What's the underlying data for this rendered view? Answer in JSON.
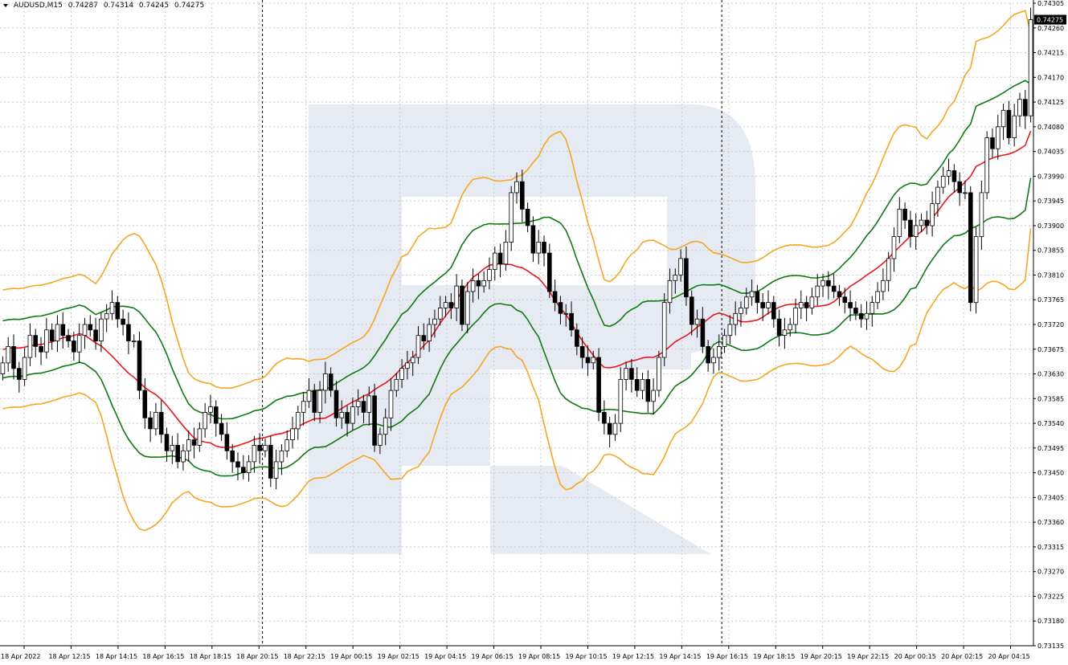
{
  "header": {
    "symbol": "AUDUSD,M15",
    "open": "0.74287",
    "high": "0.74314",
    "low": "0.74245",
    "close": "0.74275"
  },
  "colors": {
    "background": "#ffffff",
    "grid": "#c8c8c8",
    "candle_up": "#ffffff",
    "candle_down": "#000000",
    "candle_outline": "#000000",
    "middle_band": "#e8171d",
    "inner_band": "#0d7a12",
    "outer_band": "#f5a623",
    "watermark": "#e6ebf3",
    "price_tag_bg": "#000000",
    "price_tag_fg": "#ffffff"
  },
  "watermark_icon": "rounded-R-logo",
  "chart_data": {
    "type": "candlestick",
    "title": "",
    "current_price": 0.74275,
    "price_ticks": [
      "0.74305",
      "0.74260",
      "0.74215",
      "0.74170",
      "0.74125",
      "0.74080",
      "0.74035",
      "0.73990",
      "0.73945",
      "0.73900",
      "0.73855",
      "0.73810",
      "0.73765",
      "0.73720",
      "0.73675",
      "0.73630",
      "0.73585",
      "0.73540",
      "0.73495",
      "0.73450",
      "0.73405",
      "0.73360",
      "0.73315",
      "0.73270",
      "0.73225",
      "0.73180",
      "0.73135"
    ],
    "time_ticks": [
      "18 Apr 2022",
      "18 Apr 12:15",
      "18 Apr 14:15",
      "18 Apr 16:15",
      "18 Apr 18:15",
      "18 Apr 20:15",
      "18 Apr 22:15",
      "19 Apr 00:15",
      "19 Apr 02:15",
      "19 Apr 04:15",
      "19 Apr 06:15",
      "19 Apr 08:15",
      "19 Apr 10:15",
      "19 Apr 12:15",
      "19 Apr 14:15",
      "19 Apr 16:15",
      "19 Apr 18:15",
      "19 Apr 20:15",
      "19 Apr 22:15",
      "20 Apr 00:15",
      "20 Apr 02:15",
      "20 Apr 04:15"
    ],
    "ylim": [
      0.73135,
      0.74305
    ],
    "day_separators_after_bar": [
      48,
      132
    ],
    "grid": true,
    "series": [
      {
        "kind": "close",
        "values": [
          0.7365,
          0.7368,
          0.7364,
          0.7362,
          0.7366,
          0.737,
          0.7368,
          0.7367,
          0.7371,
          0.7369,
          0.7372,
          0.737,
          0.7369,
          0.7367,
          0.737,
          0.7372,
          0.7371,
          0.7369,
          0.7373,
          0.7374,
          0.7376,
          0.7373,
          0.7372,
          0.7369,
          0.7369,
          0.736,
          0.7355,
          0.7353,
          0.7356,
          0.7352,
          0.7349,
          0.735,
          0.7347,
          0.7349,
          0.7351,
          0.735,
          0.7353,
          0.7356,
          0.7357,
          0.7354,
          0.7352,
          0.7349,
          0.7347,
          0.7346,
          0.7345,
          0.7347,
          0.735,
          0.7349,
          0.735,
          0.7344,
          0.7347,
          0.7349,
          0.7351,
          0.7353,
          0.7356,
          0.7358,
          0.736,
          0.7356,
          0.736,
          0.7363,
          0.736,
          0.7355,
          0.7356,
          0.7354,
          0.7357,
          0.7358,
          0.7356,
          0.7359,
          0.735,
          0.7352,
          0.7355,
          0.736,
          0.7362,
          0.7364,
          0.7365,
          0.7366,
          0.737,
          0.7369,
          0.7372,
          0.7373,
          0.7375,
          0.7376,
          0.7375,
          0.7379,
          0.7372,
          0.7378,
          0.738,
          0.7379,
          0.738,
          0.7382,
          0.7385,
          0.7383,
          0.7387,
          0.7396,
          0.7398,
          0.7393,
          0.739,
          0.7385,
          0.7387,
          0.7385,
          0.7378,
          0.7376,
          0.7374,
          0.7374,
          0.7371,
          0.7368,
          0.7366,
          0.7365,
          0.7366,
          0.7356,
          0.7354,
          0.7352,
          0.7354,
          0.7362,
          0.7364,
          0.7362,
          0.736,
          0.7362,
          0.7358,
          0.736,
          0.7366,
          0.7376,
          0.738,
          0.7381,
          0.7384,
          0.7377,
          0.7372,
          0.7373,
          0.7368,
          0.7365,
          0.7366,
          0.7368,
          0.737,
          0.7372,
          0.7374,
          0.7375,
          0.7377,
          0.7378,
          0.7376,
          0.7375,
          0.7376,
          0.7373,
          0.737,
          0.7371,
          0.7372,
          0.7375,
          0.7376,
          0.7375,
          0.7377,
          0.7379,
          0.738,
          0.7379,
          0.7378,
          0.7377,
          0.7376,
          0.7375,
          0.7374,
          0.7373,
          0.7374,
          0.7376,
          0.7378,
          0.738,
          0.7384,
          0.7388,
          0.7393,
          0.7391,
          0.7388,
          0.739,
          0.7391,
          0.739,
          0.7394,
          0.7397,
          0.7399,
          0.74,
          0.7398,
          0.7396,
          0.7396,
          0.7376,
          0.7388,
          0.7396,
          0.7406,
          0.7404,
          0.7408,
          0.7411,
          0.7406,
          0.741,
          0.7413,
          0.741,
          0.74275
        ]
      },
      {
        "kind": "middle",
        "name": "",
        "start": 0.7362,
        "end": 0.7396
      },
      {
        "kind": "inner",
        "name": "",
        "width": 0.0013
      },
      {
        "kind": "outer",
        "name": "",
        "width": 0.0027
      }
    ]
  }
}
